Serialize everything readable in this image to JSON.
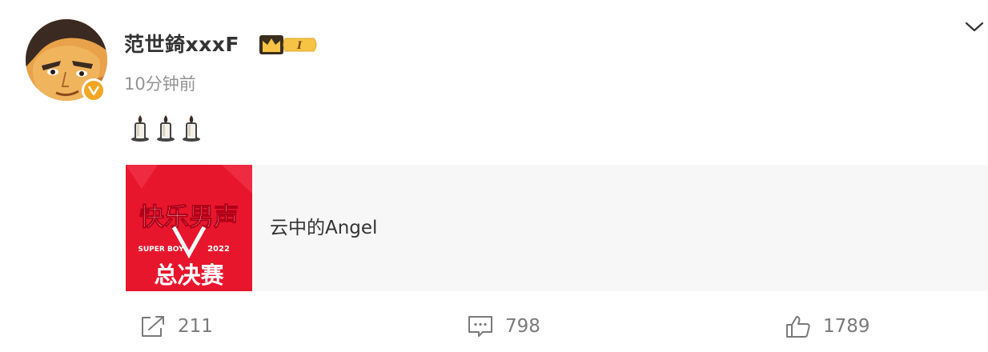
{
  "post": {
    "author": {
      "name": "范世錡xxxF",
      "avatar_icon": "cartoon-portrait-avatar",
      "verified_icon": "verified-v-badge-icon",
      "level_badge": "I",
      "level_icon": "crown-icon"
    },
    "timestamp": "10分钟前",
    "emoji": [
      "candle",
      "candle",
      "candle"
    ],
    "link_card": {
      "thumb_line1": "快乐男声",
      "thumb_tag_left": "SUPER BOY",
      "thumb_tag_right": "2022",
      "thumb_line2": "总决赛",
      "title": "云中的Angel"
    },
    "actions": {
      "repost_count": "211",
      "comment_count": "798",
      "like_count": "1789"
    }
  },
  "colors": {
    "brand_red": "#e8162d",
    "badge_gold": "#f5a623",
    "muted_text": "#939393",
    "card_bg": "#f7f7f7"
  }
}
